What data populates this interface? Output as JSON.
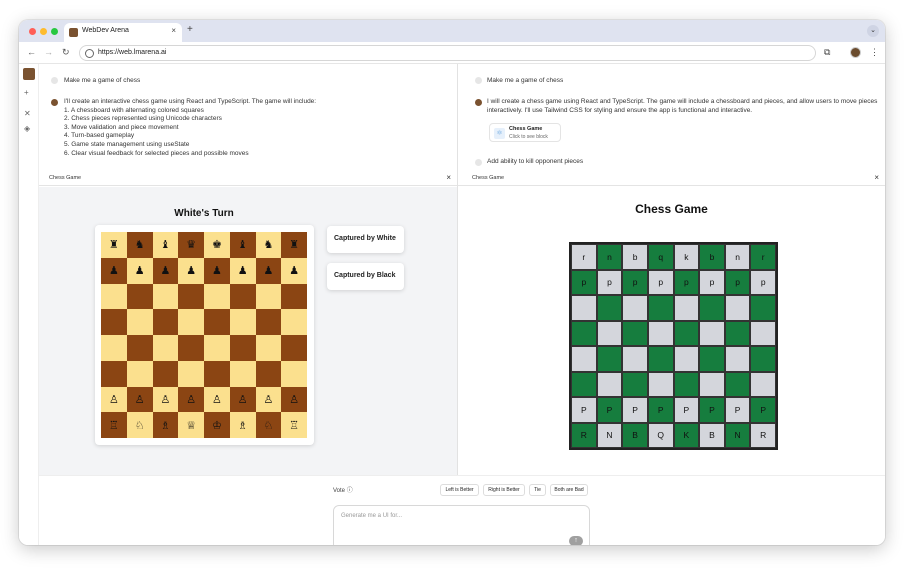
{
  "browser": {
    "tab_title": "WebDev Arena",
    "url": "https://web.lmarena.ai"
  },
  "left_chat": {
    "user_avatar": "A",
    "user_prompt": "Make me a game of chess",
    "reply_intro": "I'll create an interactive chess game using React and TypeScript. The game will include:",
    "reply_items": [
      "1. A chessboard with alternating colored squares",
      "2. Chess pieces represented using Unicode characters",
      "3. Move validation and piece movement",
      "4. Turn-based gameplay",
      "5. Game state management using useState",
      "6. Clear visual feedback for selected pieces and possible moves"
    ]
  },
  "right_chat": {
    "user_avatar": "A",
    "user_prompt": "Make me a game of chess",
    "reply_line1": "I will create a chess game using React and TypeScript. The game will include a chessboard and pieces, and allow users to move pieces",
    "reply_line2": "interactively. I'll use Tailwind CSS for styling and ensure the app is functional and interactive.",
    "chip_title": "Chess Game",
    "chip_subtitle": "Click to see block",
    "followup_avatar": "A",
    "followup_prompt": "Add ability to kill opponent pieces"
  },
  "left_panel": {
    "title": "Chess Game",
    "turn_text": "White's Turn",
    "captured_white": "Captured by White",
    "captured_black": "Captured by Black",
    "board": [
      [
        "♜",
        "♞",
        "♝",
        "♛",
        "♚",
        "♝",
        "♞",
        "♜"
      ],
      [
        "♟",
        "♟",
        "♟",
        "♟",
        "♟",
        "♟",
        "♟",
        "♟"
      ],
      [
        "",
        "",
        "",
        "",
        "",
        "",
        "",
        ""
      ],
      [
        "",
        "",
        "",
        "",
        "",
        "",
        "",
        ""
      ],
      [
        "",
        "",
        "",
        "",
        "",
        "",
        "",
        ""
      ],
      [
        "",
        "",
        "",
        "",
        "",
        "",
        "",
        ""
      ],
      [
        "♙",
        "♙",
        "♙",
        "♙",
        "♙",
        "♙",
        "♙",
        "♙"
      ],
      [
        "♖",
        "♘",
        "♗",
        "♕",
        "♔",
        "♗",
        "♘",
        "♖"
      ]
    ],
    "colors": {
      "light": "#fbe08e",
      "dark": "#8b4513"
    }
  },
  "right_panel": {
    "title": "Chess Game",
    "heading": "Chess Game",
    "board": [
      [
        "r",
        "n",
        "b",
        "q",
        "k",
        "b",
        "n",
        "r"
      ],
      [
        "p",
        "p",
        "p",
        "p",
        "p",
        "p",
        "p",
        "p"
      ],
      [
        "",
        "",
        "",
        "",
        "",
        "",
        "",
        ""
      ],
      [
        "",
        "",
        "",
        "",
        "",
        "",
        "",
        ""
      ],
      [
        "",
        "",
        "",
        "",
        "",
        "",
        "",
        ""
      ],
      [
        "",
        "",
        "",
        "",
        "",
        "",
        "",
        ""
      ],
      [
        "P",
        "P",
        "P",
        "P",
        "P",
        "P",
        "P",
        "P"
      ],
      [
        "R",
        "N",
        "B",
        "Q",
        "K",
        "B",
        "N",
        "R"
      ]
    ],
    "colors": {
      "light": "#d4d6dc",
      "dark": "#167d3e"
    }
  },
  "vote": {
    "label": "Vote",
    "buttons": [
      "Left is Better",
      "Right is Better",
      "Tie",
      "Both are Bad"
    ],
    "input_placeholder": "Generate me a UI for..."
  }
}
